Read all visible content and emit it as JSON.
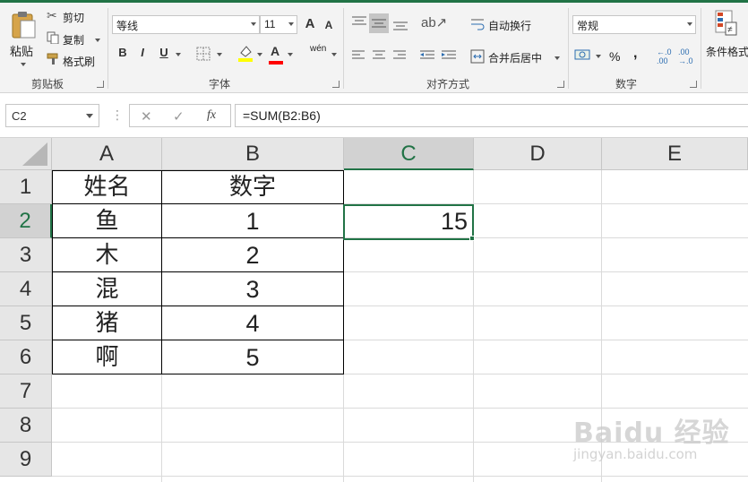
{
  "ribbon": {
    "clipboard": {
      "paste_label": "粘贴",
      "cut_label": "剪切",
      "copy_label": "复制",
      "format_painter_label": "格式刷",
      "group_label": "剪贴板"
    },
    "font": {
      "font_name": "等线",
      "font_size": "11",
      "grow_label": "A",
      "shrink_label": "A",
      "bold_label": "B",
      "italic_label": "I",
      "underline_label": "U",
      "font_color_label": "A",
      "phonetic_label": "wén",
      "group_label": "字体"
    },
    "alignment": {
      "wrap_text_label": "自动换行",
      "merge_center_label": "合并后居中",
      "group_label": "对齐方式"
    },
    "number": {
      "format_value": "常规",
      "percent_label": "%",
      "comma_label": ",",
      "group_label": "数字"
    },
    "styles": {
      "conditional_format_label": "条件格式"
    }
  },
  "formula_bar": {
    "name_box": "C2",
    "cancel_label": "✕",
    "enter_label": "✓",
    "fx_label": "fx",
    "formula": "=SUM(B2:B6)"
  },
  "sheet": {
    "columns": [
      "A",
      "B",
      "C",
      "D",
      "E"
    ],
    "active_column": "C",
    "rows": [
      "1",
      "2",
      "3",
      "4",
      "5",
      "6",
      "7",
      "8",
      "9"
    ],
    "active_row": "2",
    "cells": {
      "A1": "姓名",
      "B1": "数字",
      "A2": "鱼",
      "B2": "1",
      "C2": "15",
      "A3": "木",
      "B3": "2",
      "A4": "混",
      "B4": "3",
      "A5": "猪",
      "B5": "4",
      "A6": "啊",
      "B6": "5"
    }
  },
  "watermark": {
    "text": "Baidu 经验",
    "sub": "jingyan.baidu.com"
  },
  "colors": {
    "accent": "#217346",
    "ribbon_bg": "#f3f3f3",
    "header_bg": "#e6e6e6"
  }
}
